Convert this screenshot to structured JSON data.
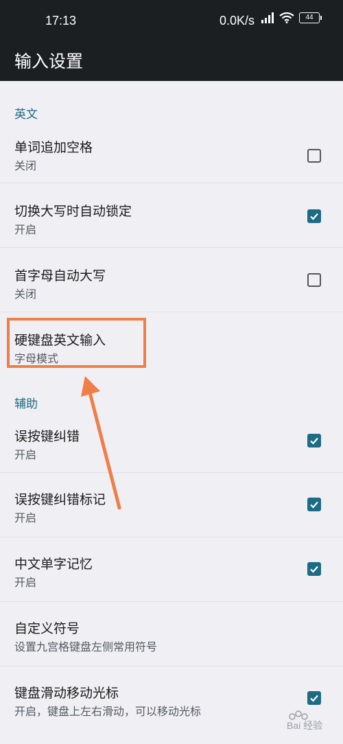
{
  "status_bar": {
    "time": "17:13",
    "network_speed": "0.0K/s",
    "battery_level": "44",
    "icons": [
      "signal-icon",
      "wifi-icon",
      "battery-icon"
    ]
  },
  "app_bar": {
    "title": "输入设置"
  },
  "sections": {
    "english": {
      "header": "英文"
    },
    "assist": {
      "header": "辅助"
    }
  },
  "items": [
    {
      "title": "单词追加空格",
      "subtitle": "关闭",
      "checked": false
    },
    {
      "title": "切换大写时自动锁定",
      "subtitle": "开启",
      "checked": true
    },
    {
      "title": "首字母自动大写",
      "subtitle": "关闭",
      "checked": false
    },
    {
      "title": "硬键盘英文输入",
      "subtitle": "字母模式",
      "checked": null
    },
    {
      "title": "误按键纠错",
      "subtitle": "开启",
      "checked": true
    },
    {
      "title": "误按键纠错标记",
      "subtitle": "开启",
      "checked": true
    },
    {
      "title": "中文单字记忆",
      "subtitle": "开启",
      "checked": true
    },
    {
      "title": "自定义符号",
      "subtitle": "设置九宫格键盘左侧常用符号",
      "checked": null
    },
    {
      "title": "键盘滑动移动光标",
      "subtitle": "开启，键盘上左右滑动，可以移动光标",
      "checked": true
    }
  ],
  "annotation": {
    "color": "#ef7e47"
  },
  "colors": {
    "accent": "#1c6c84",
    "app_bar": "#1c1f22",
    "background": "#f0eff4"
  },
  "watermark": {
    "text": "Baidu 经验"
  }
}
